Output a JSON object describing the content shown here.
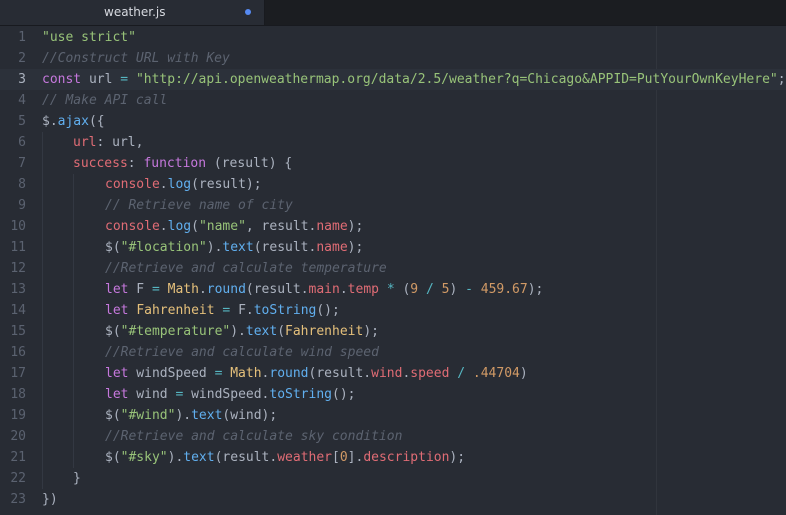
{
  "tab": {
    "filename": "weather.js",
    "modified": true
  },
  "colors": {
    "string": "#98c379",
    "comment": "#5c6370",
    "keyword": "#c678dd",
    "function": "#61afef",
    "property": "#e06c75",
    "number": "#d19a66",
    "class": "#e5c07b",
    "operator": "#56b6c2",
    "plain": "#abb2bf",
    "modified_dot": "#568af2"
  },
  "editor": {
    "active_line": 3,
    "lines": [
      {
        "num": 1,
        "indent": 0,
        "tokens": [
          [
            "str",
            "\"use strict\""
          ]
        ]
      },
      {
        "num": 2,
        "indent": 0,
        "tokens": [
          [
            "cmt",
            "//Construct URL with Key"
          ]
        ]
      },
      {
        "num": 3,
        "indent": 0,
        "tokens": [
          [
            "kw",
            "const"
          ],
          [
            "pl",
            " url "
          ],
          [
            "op",
            "="
          ],
          [
            "pl",
            " "
          ],
          [
            "str",
            "\"http://api.openweathermap.org/data/2.5/weather?q=Chicago&APPID=PutYourOwnKeyHere\""
          ],
          [
            "pl",
            ";"
          ]
        ]
      },
      {
        "num": 4,
        "indent": 0,
        "tokens": [
          [
            "cmt",
            "// Make API call"
          ]
        ]
      },
      {
        "num": 5,
        "indent": 0,
        "tokens": [
          [
            "pl",
            "$."
          ],
          [
            "fn",
            "ajax"
          ],
          [
            "pl",
            "({"
          ]
        ]
      },
      {
        "num": 6,
        "indent": 1,
        "tokens": [
          [
            "prop",
            "url"
          ],
          [
            "pl",
            ": url,"
          ]
        ]
      },
      {
        "num": 7,
        "indent": 1,
        "tokens": [
          [
            "prop",
            "success"
          ],
          [
            "pl",
            ": "
          ],
          [
            "kw",
            "function"
          ],
          [
            "pl",
            " (result) {"
          ]
        ]
      },
      {
        "num": 8,
        "indent": 2,
        "tokens": [
          [
            "prop",
            "console"
          ],
          [
            "pl",
            "."
          ],
          [
            "fn",
            "log"
          ],
          [
            "pl",
            "(result);"
          ]
        ]
      },
      {
        "num": 9,
        "indent": 2,
        "tokens": [
          [
            "cmt",
            "// Retrieve name of city"
          ]
        ]
      },
      {
        "num": 10,
        "indent": 2,
        "tokens": [
          [
            "prop",
            "console"
          ],
          [
            "pl",
            "."
          ],
          [
            "fn",
            "log"
          ],
          [
            "pl",
            "("
          ],
          [
            "str",
            "\"name\""
          ],
          [
            "pl",
            ", result."
          ],
          [
            "prop",
            "name"
          ],
          [
            "pl",
            ");"
          ]
        ]
      },
      {
        "num": 11,
        "indent": 2,
        "tokens": [
          [
            "pl",
            "$("
          ],
          [
            "str",
            "\"#location\""
          ],
          [
            "pl",
            ")."
          ],
          [
            "fn",
            "text"
          ],
          [
            "pl",
            "(result."
          ],
          [
            "prop",
            "name"
          ],
          [
            "pl",
            ");"
          ]
        ]
      },
      {
        "num": 12,
        "indent": 2,
        "tokens": [
          [
            "cmt",
            "//Retrieve and calculate temperature"
          ]
        ]
      },
      {
        "num": 13,
        "indent": 2,
        "tokens": [
          [
            "kw",
            "let"
          ],
          [
            "pl",
            " F "
          ],
          [
            "op",
            "="
          ],
          [
            "pl",
            " "
          ],
          [
            "cls",
            "Math"
          ],
          [
            "pl",
            "."
          ],
          [
            "fn",
            "round"
          ],
          [
            "pl",
            "(result."
          ],
          [
            "prop",
            "main"
          ],
          [
            "pl",
            "."
          ],
          [
            "prop",
            "temp"
          ],
          [
            "pl",
            " "
          ],
          [
            "op",
            "*"
          ],
          [
            "pl",
            " ("
          ],
          [
            "num",
            "9"
          ],
          [
            "pl",
            " "
          ],
          [
            "op",
            "/"
          ],
          [
            "pl",
            " "
          ],
          [
            "num",
            "5"
          ],
          [
            "pl",
            ") "
          ],
          [
            "op",
            "-"
          ],
          [
            "pl",
            " "
          ],
          [
            "num",
            "459.67"
          ],
          [
            "pl",
            ");"
          ]
        ]
      },
      {
        "num": 14,
        "indent": 2,
        "tokens": [
          [
            "kw",
            "let"
          ],
          [
            "pl",
            " "
          ],
          [
            "cls",
            "Fahrenheit"
          ],
          [
            "pl",
            " "
          ],
          [
            "op",
            "="
          ],
          [
            "pl",
            " F."
          ],
          [
            "fn",
            "toString"
          ],
          [
            "pl",
            "();"
          ]
        ]
      },
      {
        "num": 15,
        "indent": 2,
        "tokens": [
          [
            "pl",
            "$("
          ],
          [
            "str",
            "\"#temperature\""
          ],
          [
            "pl",
            ")."
          ],
          [
            "fn",
            "text"
          ],
          [
            "pl",
            "("
          ],
          [
            "cls",
            "Fahrenheit"
          ],
          [
            "pl",
            ");"
          ]
        ]
      },
      {
        "num": 16,
        "indent": 2,
        "tokens": [
          [
            "cmt",
            "//Retrieve and calculate wind speed"
          ]
        ]
      },
      {
        "num": 17,
        "indent": 2,
        "tokens": [
          [
            "kw",
            "let"
          ],
          [
            "pl",
            " windSpeed "
          ],
          [
            "op",
            "="
          ],
          [
            "pl",
            " "
          ],
          [
            "cls",
            "Math"
          ],
          [
            "pl",
            "."
          ],
          [
            "fn",
            "round"
          ],
          [
            "pl",
            "(result."
          ],
          [
            "prop",
            "wind"
          ],
          [
            "pl",
            "."
          ],
          [
            "prop",
            "speed"
          ],
          [
            "pl",
            " "
          ],
          [
            "op",
            "/"
          ],
          [
            "pl",
            " "
          ],
          [
            "num",
            ".44704"
          ],
          [
            "pl",
            ")"
          ]
        ]
      },
      {
        "num": 18,
        "indent": 2,
        "tokens": [
          [
            "kw",
            "let"
          ],
          [
            "pl",
            " wind "
          ],
          [
            "op",
            "="
          ],
          [
            "pl",
            " windSpeed."
          ],
          [
            "fn",
            "toString"
          ],
          [
            "pl",
            "();"
          ]
        ]
      },
      {
        "num": 19,
        "indent": 2,
        "tokens": [
          [
            "pl",
            "$("
          ],
          [
            "str",
            "\"#wind\""
          ],
          [
            "pl",
            ")."
          ],
          [
            "fn",
            "text"
          ],
          [
            "pl",
            "(wind);"
          ]
        ]
      },
      {
        "num": 20,
        "indent": 2,
        "tokens": [
          [
            "cmt",
            "//Retrieve and calculate sky condition"
          ]
        ]
      },
      {
        "num": 21,
        "indent": 2,
        "tokens": [
          [
            "pl",
            "$("
          ],
          [
            "str",
            "\"#sky\""
          ],
          [
            "pl",
            ")."
          ],
          [
            "fn",
            "text"
          ],
          [
            "pl",
            "(result."
          ],
          [
            "prop",
            "weather"
          ],
          [
            "pl",
            "["
          ],
          [
            "num",
            "0"
          ],
          [
            "pl",
            "]."
          ],
          [
            "prop",
            "description"
          ],
          [
            "pl",
            ");"
          ]
        ]
      },
      {
        "num": 22,
        "indent": 1,
        "tokens": [
          [
            "pl",
            "}"
          ]
        ]
      },
      {
        "num": 23,
        "indent": 0,
        "tokens": [
          [
            "pl",
            "})"
          ]
        ]
      }
    ]
  }
}
